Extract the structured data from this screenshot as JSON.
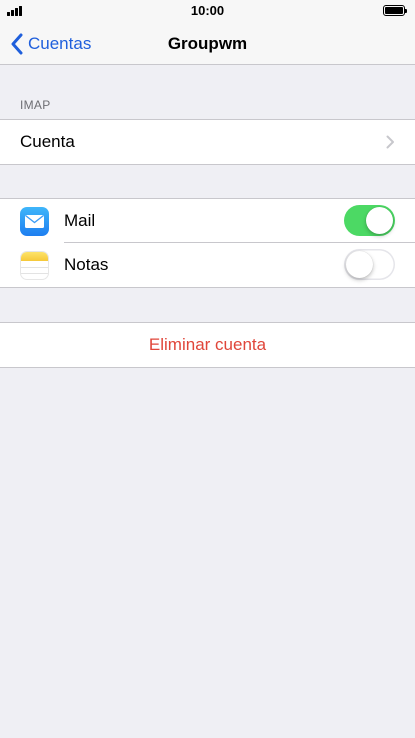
{
  "status_bar": {
    "time": "10:00"
  },
  "nav": {
    "back_label": "Cuentas",
    "title": "Groupwm"
  },
  "imap_section": {
    "header": "IMAP",
    "account_label": "Cuenta"
  },
  "apps": [
    {
      "label": "Mail",
      "enabled": true
    },
    {
      "label": "Notas",
      "enabled": false
    }
  ],
  "delete_label": "Eliminar cuenta",
  "colors": {
    "accent": "#1f5fdc",
    "toggle_on": "#4cd964",
    "destructive": "#e0463a",
    "background": "#efeff4"
  }
}
